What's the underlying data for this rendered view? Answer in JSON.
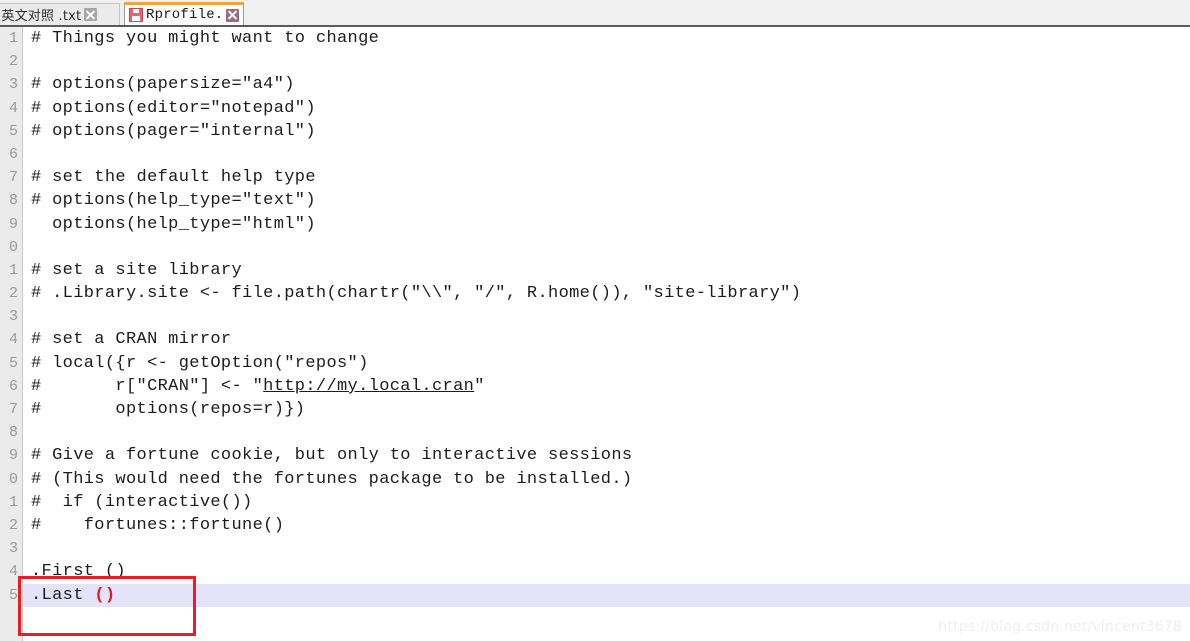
{
  "tabbar": {
    "tabs": [
      {
        "title": "用中英文对照 .txt",
        "active": false,
        "close_label": "close-tab",
        "icon": "none"
      },
      {
        "title": "Rprofile.site",
        "active": true,
        "close_label": "close-tab",
        "icon": "floppy-save-icon"
      }
    ]
  },
  "editor": {
    "lines": [
      {
        "n": "1",
        "text": "# Things you might want to change"
      },
      {
        "n": "2",
        "text": ""
      },
      {
        "n": "3",
        "text": "# options(papersize=\"a4\")"
      },
      {
        "n": "4",
        "text": "# options(editor=\"notepad\")"
      },
      {
        "n": "5",
        "text": "# options(pager=\"internal\")"
      },
      {
        "n": "6",
        "text": ""
      },
      {
        "n": "7",
        "text": "# set the default help type"
      },
      {
        "n": "8",
        "text": "# options(help_type=\"text\")"
      },
      {
        "n": "9",
        "text": "  options(help_type=\"html\")"
      },
      {
        "n": "0",
        "text": ""
      },
      {
        "n": "1",
        "text": "# set a site library"
      },
      {
        "n": "2",
        "text": "# .Library.site <- file.path(chartr(\"\\\\\", \"/\", R.home()), \"site-library\")"
      },
      {
        "n": "3",
        "text": ""
      },
      {
        "n": "4",
        "text": "# set a CRAN mirror"
      },
      {
        "n": "5",
        "text": "# local({r <- getOption(\"repos\")"
      },
      {
        "n": "6",
        "text": "#       r[\"CRAN\"] <- \"http://my.local.cran\"",
        "link": "http://my.local.cran"
      },
      {
        "n": "7",
        "text": "#       options(repos=r)})"
      },
      {
        "n": "8",
        "text": ""
      },
      {
        "n": "9",
        "text": "# Give a fortune cookie, but only to interactive sessions"
      },
      {
        "n": "0",
        "text": "# (This would need the fortunes package to be installed.)"
      },
      {
        "n": "1",
        "text": "#  if (interactive())"
      },
      {
        "n": "2",
        "text": "#    fortunes::fortune()"
      },
      {
        "n": "3",
        "text": ""
      },
      {
        "n": "4",
        "text": ".First ()"
      },
      {
        "n": "5",
        "text": ".Last ",
        "paren": "()",
        "current": true
      }
    ]
  },
  "annotation": {
    "label": "red-highlight-box"
  },
  "watermark": {
    "text": "https://blog.csdn.net/vincent3678"
  },
  "colors": {
    "accent_tab_top": "#f2a33c",
    "current_line": "#e3e3fa",
    "annotation": "#ed1c24",
    "paren_highlight": "#e01b1b",
    "gutter_bg": "#ebebeb"
  }
}
